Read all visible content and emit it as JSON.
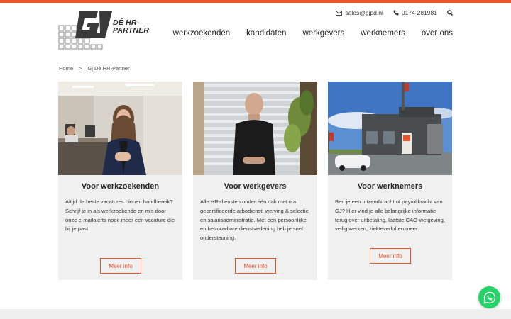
{
  "brand": {
    "logo_letters": "GJ",
    "logo_text": "DÉ HR-PARTNER",
    "accent_color": "#e8552a"
  },
  "contact": {
    "email": "sales@gjpd.nl",
    "phone": "0174-281981",
    "email_icon": "envelope-icon",
    "phone_icon": "phone-icon",
    "search_icon": "search-icon"
  },
  "nav": {
    "items": [
      "werkzoekenden",
      "kandidaten",
      "werkgevers",
      "werknemers",
      "over ons"
    ]
  },
  "breadcrumb": {
    "home": "Home",
    "separator": ">",
    "current": "Gj Dé HR-Partner"
  },
  "cards": [
    {
      "title": "Voor werkzoekenden",
      "text": "Altijd de beste vacatures binnen handbereik? Schrijf je in als werkzoekende en mis door onze e-mailalerts nooit meer een vacature die bij je past.",
      "button": "Meer info"
    },
    {
      "title": "Voor werkgevers",
      "text": "Alle HR-diensten onder één dak met o.a. gecertificeerde arbodienst, werving & selectie en salarisadministratie. Met een persoonlijke en betrouwbare dienstverlening heb je snel ondersteuning.",
      "button": "Meer info"
    },
    {
      "title": "Voor werknemers",
      "text": "Ben je een uitzendkracht of payrollkracht van GJ? Hier vind je alle belangrijke informatie terug over uitbetaling, laatste CAO-wetgeving, veilig werken, ziekteverlof en meer.",
      "button": "Meer info"
    }
  ],
  "chat": {
    "icon": "whatsapp-icon",
    "color": "#25d366"
  }
}
